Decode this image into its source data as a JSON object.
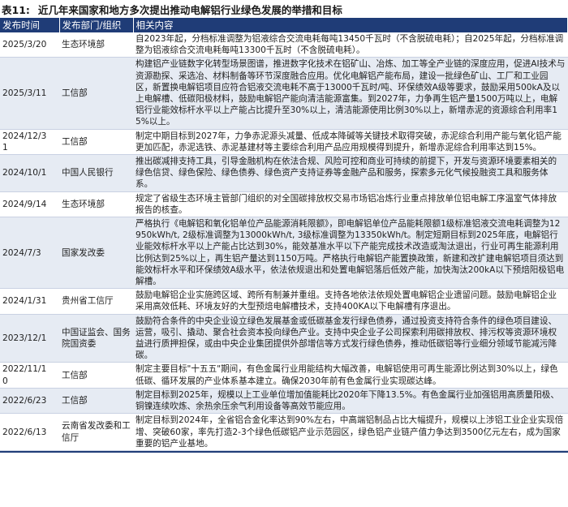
{
  "title": {
    "number": "表11:",
    "text": "近几年来国家和地方多次提出推动电解铝行业绿色发展的举措和目标"
  },
  "headers": [
    "发布时间",
    "发布部门/组织",
    "相关内容"
  ],
  "rows": [
    {
      "date": "2025/3/20",
      "dept": "生态环境部",
      "content": "自2023年起，分档标准调整为铝液综合交流电耗每吨13450千瓦时（不含脱硫电耗）；自2025年起，分档标准调整为铝液综合交流电耗每吨13300千瓦时（不含脱硫电耗）。"
    },
    {
      "date": "2025/3/11",
      "dept": "工信部",
      "content": "构建铝产业链数字化转型场景图谱，推进数字化技术在铝矿山、冶炼、加工等全产业链的深度应用，促进AI技术与资源勘探、采选冶、材料制备等环节深度融合应用。优化电解铝产能布局，建设一批绿色矿山、工厂和工业园区，新置换电解铝项目应符合铝液交流电耗不高于13000千瓦时/吨、环保绩效A级等要求，鼓励采用500kA及以上电解槽、低碳阳极材料，鼓励电解铝产能向清洁能源富集。到2027年，力争再生铝产量1500万吨以上，电解铝行业能效标杆水平以上产能占比提升至30%以上，清洁能源使用比例30%以上，新增赤泥的资源综合利用率15%以上。"
    },
    {
      "date": "2024/12/3\n1",
      "dept": "工信部",
      "content": "制定中期目标到2027年，力争赤泥源头减量、低成本降碱等关键技术取得突破，赤泥综合利用产能与氧化铝产能更加匹配，赤泥选铁、赤泥基建材等主要综合利用产品应用规模得到提升，新增赤泥综合利用率达到15%。"
    },
    {
      "date": "2024/10/1",
      "dept": "中国人民银行",
      "content": "推出碳减排支持工具，引导金融机构在依法合规、风险可控和商业可持续的前提下，开发与资源环境要素相关的绿色信贷、绿色保险、绿色债券、绿色资产支持证券等金融产品和服务，探索多元化气候投融资工具和服务体系。"
    },
    {
      "date": "2024/9/14",
      "dept": "生态环境部",
      "content": "规定了省级生态环境主管部门组织的对全国碳排放权交易市场铝冶炼行业重点排放单位铝电解工序温室气体排放报告的核查。"
    },
    {
      "date": "2024/7/3",
      "dept": "国家发改委",
      "content": "严格执行《电解铝和氧化铝单位产品能源消耗限额》，即电解铝单位产品能耗限额1级标准铝液交流电耗调整为12950kWh/t, 2级标准调整为13000kWh/t, 3级标准调整为13350kWh/t。制定短期目标到2025年底，电解铝行业能效标杆水平以上产能占比达到30%，能效基准水平以下产能完成技术改造或淘汰退出，行业可再生能源利用比例达到25%以上，再生铝产量达到1150万吨。严格执行电解铝产能置换政策，新建和改扩建电解铝项目须达到能效标杆水平和环保绩效A级水平，依法依规退出和处置电解铝落后低效产能，加快淘汰200kA以下预焙阳极铝电解槽。"
    },
    {
      "date": "2024/1/31",
      "dept": "贵州省工信厅",
      "content": "鼓励电解铝企业实施跨区域、跨所有制兼并重组。支持各地依法依规处置电解铝企业遗留问题。鼓励电解铝企业采用高效低耗、环境友好的大型预焙电解槽技术，支持400KA以下电解槽有序退出。"
    },
    {
      "date": "2023/12/1",
      "dept": "中国证监会、国务院国资委",
      "content": "鼓励符合条件的中央企业设立绿色发展基金或低碳基金发行绿色债券，通过投资支持符合条件的绿色项目建设、运营，吸引、撬动、聚合社会资本投向绿色产业。支持中央企业子公司探索利用碳排放权、排污权等资源环境权益进行质押担保，或由中央企业集团提供外部增信等方式发行绿色债券，推动低碳铝等行业细分领域节能减污降碳。"
    },
    {
      "date": "2022/11/1\n0",
      "dept": "工信部",
      "content": "制定主要目标\"十五五\"期间，有色金属行业用能结构大幅改善，电解铝使用可再生能源比例达到30%以上，绿色低碳、循环发展的产业体系基本建立。确保2030年前有色金属行业实现碳达峰。"
    },
    {
      "date": "2022/6/23",
      "dept": "工信部",
      "content": "制定目标到2025年，规模以上工业单位增加值能耗比2020年下降13.5%。有色金属行业加强铝用高质量阳极、铜镍连续吹炼、余热余压余气利用设备等高效节能应用。"
    },
    {
      "date": "2022/6/13",
      "dept": "云南省发改委和工信厅",
      "content": "制定目标到2024年，全省铝合金化率达到90%左右，中高端铝制品占比大幅提升，规模以上涉铝工业企业实现倍增、突破60家，率先打造2-3个绿色低碳铝产业示范园区，绿色铝产业链产值力争达到3500亿元左右，成为国家重要的铝产业基地。"
    }
  ],
  "colors": {
    "header_bg": "#1f3c77",
    "alt_row_bg": "#e6ebf3"
  }
}
